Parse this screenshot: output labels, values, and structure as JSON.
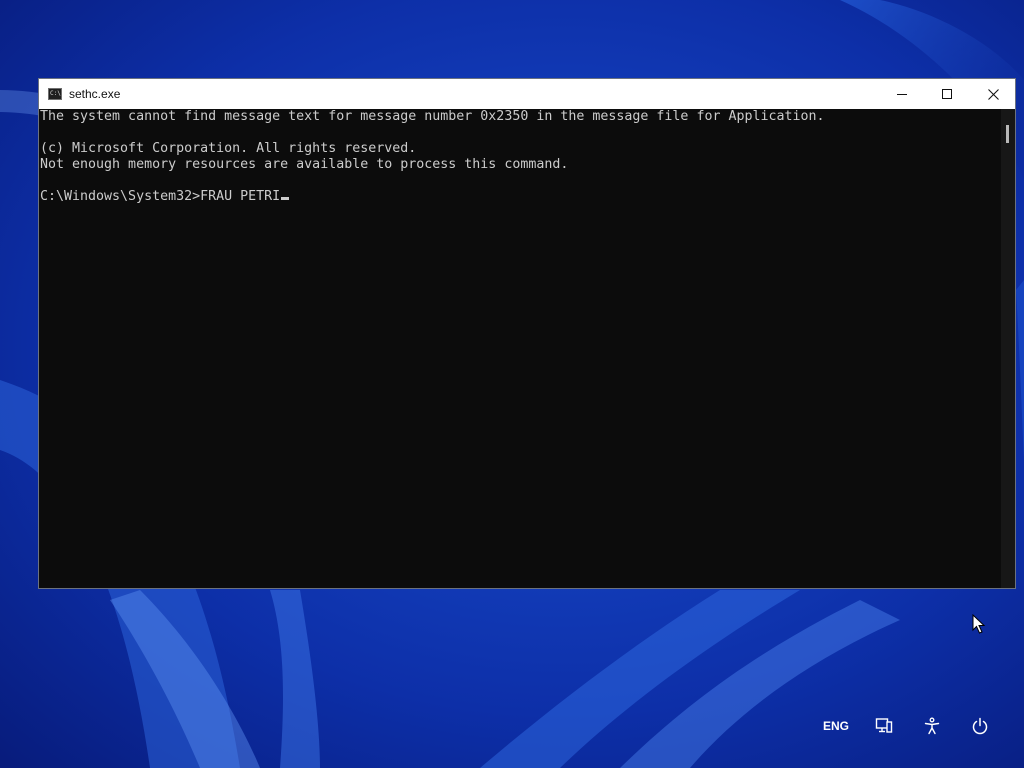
{
  "window": {
    "title": "sethc.exe",
    "icon": "console-icon",
    "icon_glyph": "C:\\"
  },
  "controls": {
    "minimize_icon": "minimize-icon",
    "maximize_icon": "maximize-icon",
    "close_icon": "close-icon"
  },
  "console": {
    "lines": [
      "The system cannot find message text for message number 0x2350 in the message file for Application.",
      "",
      "(c) Microsoft Corporation. All rights reserved.",
      "Not enough memory resources are available to process this command.",
      ""
    ],
    "prompt": "C:\\Windows\\System32>",
    "input": "FRAU PETRI"
  },
  "tray": {
    "language": "ENG",
    "network_icon": "network-icon",
    "accessibility_icon": "accessibility-icon",
    "power_icon": "power-icon"
  },
  "colors": {
    "console_bg": "#0c0c0c",
    "console_text": "#cccccc",
    "titlebar_bg": "#ffffff",
    "desktop_bg": "#0b2aa0"
  }
}
